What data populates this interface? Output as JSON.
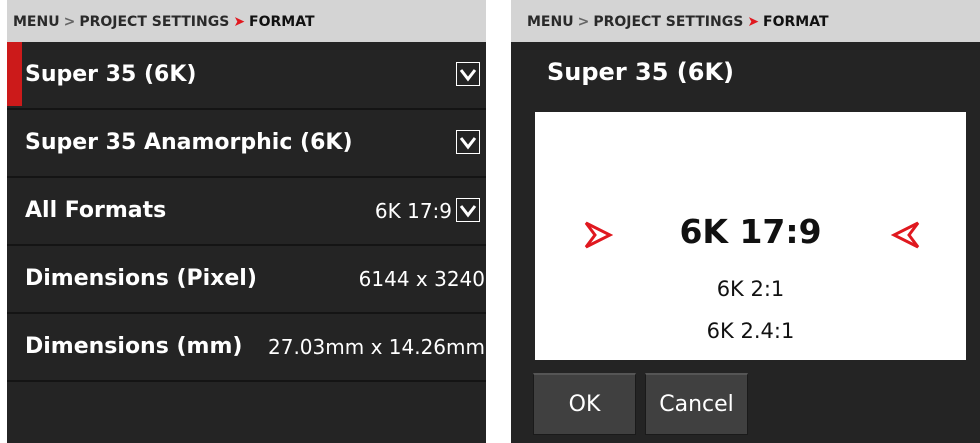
{
  "breadcrumb": {
    "menu": "MENU",
    "sep1": ">",
    "section": "PROJECT SETTINGS",
    "sep2": "➤",
    "current": "FORMAT"
  },
  "list": {
    "rows": [
      {
        "label": "Super 35 (6K)",
        "value": "",
        "dropdown": true,
        "selected": true
      },
      {
        "label": "Super 35 Anamorphic (6K)",
        "value": "",
        "dropdown": true
      },
      {
        "label": "All Formats",
        "value": "6K 17:9",
        "dropdown": true
      },
      {
        "label": "Dimensions (Pixel)",
        "value": "6144 x 3240",
        "dropdown": false
      },
      {
        "label": "Dimensions (mm)",
        "value": "27.03mm x 14.26mm",
        "dropdown": false
      }
    ]
  },
  "dialog": {
    "title": "Super 35 (6K)",
    "options": [
      "6K 17:9",
      "6K 2:1",
      "6K 2.4:1"
    ],
    "selected_index": 0,
    "ok_label": "OK",
    "cancel_label": "Cancel"
  },
  "icons": {
    "dropdown": "chevron-down-icon",
    "picker_left": "arrow-right-icon",
    "picker_right": "arrow-left-icon"
  },
  "colors": {
    "accent": "#e0181f",
    "background": "#242424",
    "breadcrumb_bg": "#d4d4d4",
    "button_bg": "#404040"
  }
}
